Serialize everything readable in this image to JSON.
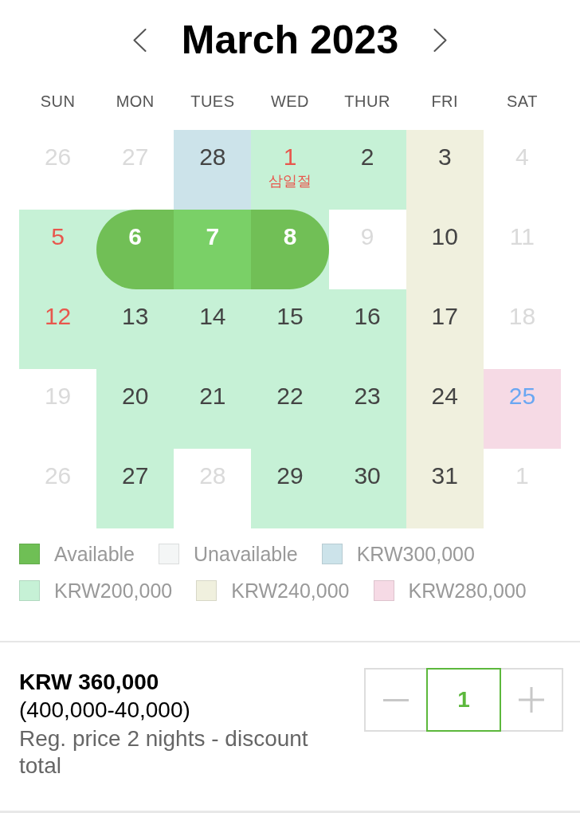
{
  "header": {
    "title": "March 2023"
  },
  "weekdays": [
    "SUN",
    "MON",
    "TUES",
    "WED",
    "THUR",
    "FRI",
    "SAT"
  ],
  "weeks": [
    {
      "days": [
        {
          "label": "26",
          "available": false,
          "selected": false
        },
        {
          "label": "27",
          "available": false,
          "selected": false
        },
        {
          "label": "28",
          "available": true,
          "selected": false,
          "color": "#cce3ea"
        },
        {
          "label": "1",
          "available": true,
          "selected": false,
          "color": "#c6f1d6",
          "note": "삼일절"
        },
        {
          "label": "2",
          "available": true,
          "selected": false,
          "color": "#c6f1d6"
        },
        {
          "label": "3",
          "available": true,
          "selected": false,
          "color": "#f0f0de"
        },
        {
          "label": "4",
          "available": false,
          "selected": false
        }
      ]
    },
    {
      "days": [
        {
          "label": "5",
          "available": true,
          "selected": false,
          "color": "#c6f1d6"
        },
        {
          "label": "6",
          "available": true,
          "selected": true,
          "color": "#c6f1d6"
        },
        {
          "label": "7",
          "available": true,
          "selected": true
        },
        {
          "label": "8",
          "available": true,
          "selected": true,
          "color": "#c6f1d6"
        },
        {
          "label": "9",
          "available": false,
          "selected": false
        },
        {
          "label": "10",
          "available": true,
          "selected": false,
          "color": "#f0f0de"
        },
        {
          "label": "11",
          "available": false,
          "selected": false
        }
      ]
    },
    {
      "days": [
        {
          "label": "12",
          "available": true,
          "selected": false,
          "color": "#c6f1d6"
        },
        {
          "label": "13",
          "available": true,
          "selected": false,
          "color": "#c6f1d6"
        },
        {
          "label": "14",
          "available": true,
          "selected": false,
          "color": "#c6f1d6"
        },
        {
          "label": "15",
          "available": true,
          "selected": false,
          "color": "#c6f1d6"
        },
        {
          "label": "16",
          "available": true,
          "selected": false,
          "color": "#c6f1d6"
        },
        {
          "label": "17",
          "available": true,
          "selected": false,
          "color": "#f0f0de"
        },
        {
          "label": "18",
          "available": false,
          "selected": false
        }
      ]
    },
    {
      "days": [
        {
          "label": "19",
          "available": false,
          "selected": false
        },
        {
          "label": "20",
          "available": true,
          "selected": false,
          "color": "#c6f1d6"
        },
        {
          "label": "21",
          "available": true,
          "selected": false,
          "color": "#c6f1d6"
        },
        {
          "label": "22",
          "available": true,
          "selected": false,
          "color": "#c6f1d6"
        },
        {
          "label": "23",
          "available": true,
          "selected": false,
          "color": "#c6f1d6"
        },
        {
          "label": "24",
          "available": true,
          "selected": false,
          "color": "#f0f0de"
        },
        {
          "label": "25",
          "available": true,
          "selected": false,
          "color": "#f6dae5"
        }
      ]
    },
    {
      "days": [
        {
          "label": "26",
          "available": false,
          "selected": false
        },
        {
          "label": "27",
          "available": true,
          "selected": false,
          "color": "#c6f1d6"
        },
        {
          "label": "28",
          "available": false,
          "selected": false
        },
        {
          "label": "29",
          "available": true,
          "selected": false,
          "color": "#c6f1d6"
        },
        {
          "label": "30",
          "available": true,
          "selected": false,
          "color": "#c6f1d6"
        },
        {
          "label": "31",
          "available": true,
          "selected": false,
          "color": "#f0f0de"
        },
        {
          "label": "1",
          "available": false,
          "selected": false
        }
      ]
    }
  ],
  "legend": [
    {
      "label": "Available",
      "color": "#6fbf55"
    },
    {
      "label": "Unavailable",
      "color": "#f4f6f6"
    },
    {
      "label": "KRW300,000",
      "color": "#cce3ea"
    },
    {
      "label": "KRW200,000",
      "color": "#c6f1d6"
    },
    {
      "label": "KRW240,000",
      "color": "#f0f0de"
    },
    {
      "label": "KRW280,000",
      "color": "#f6dae5"
    }
  ],
  "summary": {
    "price": "KRW 360,000",
    "breakdown": "(400,000-40,000)",
    "note": "Reg. price 2 nights - discount total"
  },
  "quantity": {
    "value": "1"
  }
}
